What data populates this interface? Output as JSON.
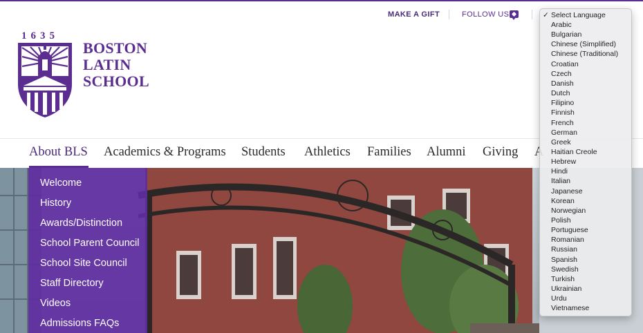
{
  "utility": {
    "make_a_gift": "MAKE A GIFT",
    "follow_us": "FOLLOW US"
  },
  "logo": {
    "year": "1635",
    "line1": "BOSTON",
    "line2": "LATIN",
    "line3": "SCHOOL"
  },
  "nav": {
    "items": [
      "About BLS",
      "Academics & Programs",
      "Students",
      "Athletics",
      "Families",
      "Alumni",
      "Giving",
      "A"
    ],
    "active": "About BLS"
  },
  "submenu": {
    "items": [
      "Welcome",
      "History",
      "Awards/Distinction",
      "School Parent Council",
      "School Site Council",
      "Staff Directory",
      "Videos",
      "Admissions FAQs"
    ]
  },
  "language": {
    "selected": "Select Language",
    "options": [
      "Arabic",
      "Bulgarian",
      "Chinese (Simplified)",
      "Chinese (Traditional)",
      "Croatian",
      "Czech",
      "Danish",
      "Dutch",
      "Filipino",
      "Finnish",
      "French",
      "German",
      "Greek",
      "Haitian Creole",
      "Hebrew",
      "Hindi",
      "Italian",
      "Japanese",
      "Korean",
      "Norwegian",
      "Polish",
      "Portuguese",
      "Romanian",
      "Russian",
      "Spanish",
      "Swedish",
      "Turkish",
      "Ukrainian",
      "Urdu",
      "Vietnamese"
    ]
  },
  "colors": {
    "brand_purple": "#5b2d90",
    "submenu_bg": "#5f2da0"
  },
  "icons": {
    "follow": "speech-bubble-icon",
    "check": "checkmark-icon"
  }
}
